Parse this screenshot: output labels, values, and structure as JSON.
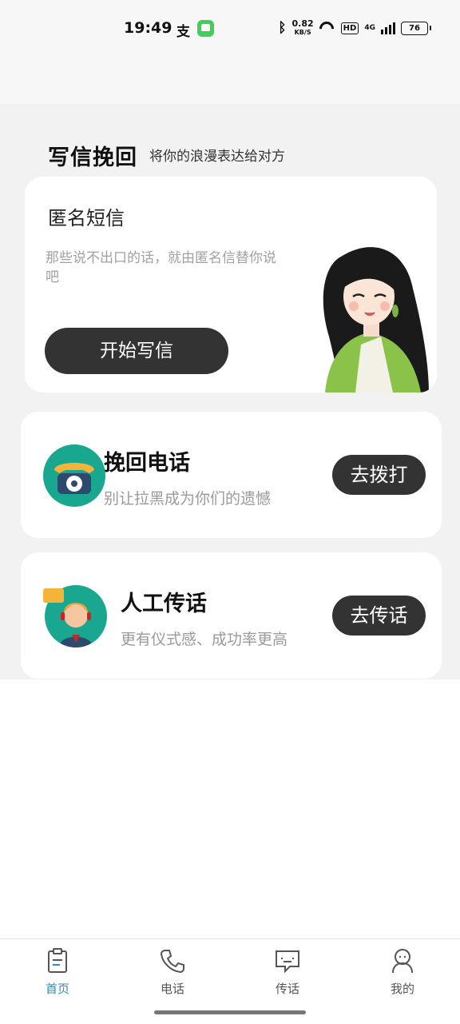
{
  "status_bar": {
    "time": "19:49",
    "alipay_icon": "支",
    "messages_icon": "message-app-icon",
    "network_speed_value": "0.82",
    "network_speed_unit": "KB/S",
    "hd_label": "HD",
    "signal_label": "4G",
    "battery": "76"
  },
  "section": {
    "title": "写信挽回",
    "subtitle": "将你的浪漫表达给对方"
  },
  "letter_card": {
    "title": "匿名短信",
    "description": "那些说不出口的话，就由匿名信替你说吧",
    "button": "开始写信"
  },
  "phone_card": {
    "title": "挽回电话",
    "description": "别让拉黑成为你们的遗憾",
    "button": "去拨打"
  },
  "relay_card": {
    "title": "人工传话",
    "description": "更有仪式感、成功率更高",
    "button": "去传话"
  },
  "tabs": [
    {
      "label": "首页",
      "icon": "clipboard-icon",
      "active": true
    },
    {
      "label": "电话",
      "icon": "phone-icon",
      "active": false
    },
    {
      "label": "传话",
      "icon": "chat-icon",
      "active": false
    },
    {
      "label": "我的",
      "icon": "person-icon",
      "active": false
    }
  ],
  "colors": {
    "accent": "#2b8fb5",
    "button_dark": "#333333",
    "avatar_bg": "#19a88f",
    "page_bg": "#f2f2f2"
  }
}
